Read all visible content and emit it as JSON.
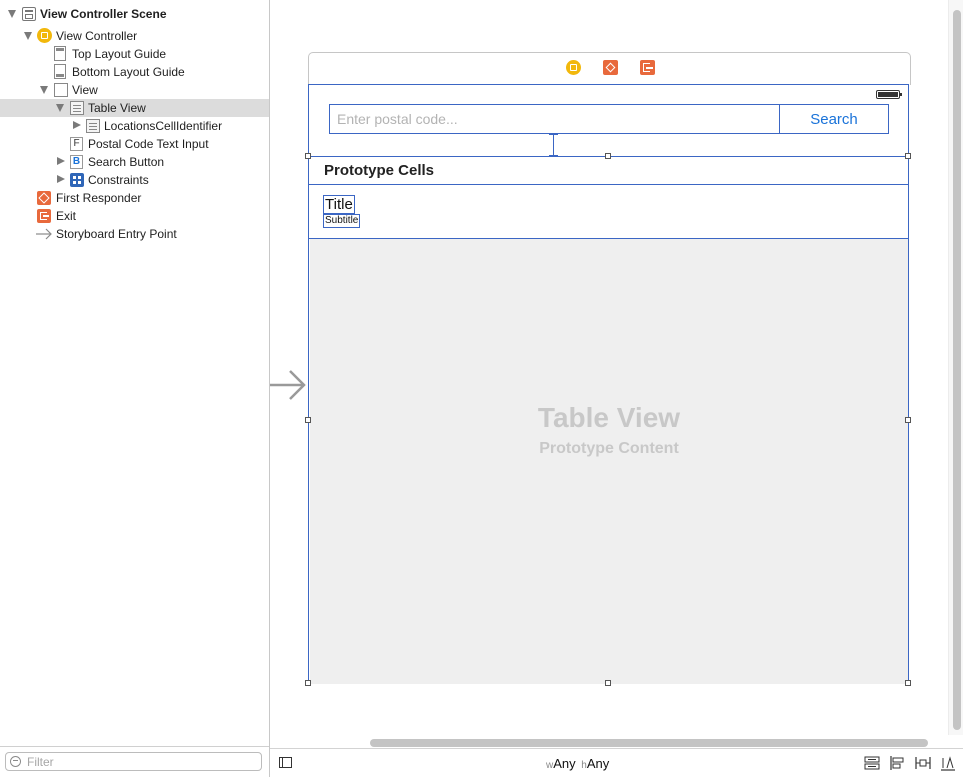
{
  "outline": {
    "items": [
      {
        "label": "View Controller Scene",
        "icon": "scene-icon"
      },
      {
        "label": "View Controller",
        "icon": "view-controller-icon"
      },
      {
        "label": "Top Layout Guide",
        "icon": "layout-guide-icon"
      },
      {
        "label": "Bottom Layout Guide",
        "icon": "layout-guide-icon"
      },
      {
        "label": "View",
        "icon": "view-icon"
      },
      {
        "label": "Table View",
        "icon": "table-view-icon"
      },
      {
        "label": "LocationsCellIdentifier",
        "icon": "table-cell-icon"
      },
      {
        "label": "Postal Code Text Input",
        "icon": "text-field-icon",
        "badge": "F"
      },
      {
        "label": "Search Button",
        "icon": "button-icon",
        "badge": "B"
      },
      {
        "label": "Constraints",
        "icon": "constraints-icon"
      },
      {
        "label": "First Responder",
        "icon": "first-responder-icon"
      },
      {
        "label": "Exit",
        "icon": "exit-icon"
      },
      {
        "label": "Storyboard Entry Point",
        "icon": "entry-arrow-icon"
      }
    ],
    "filter_placeholder": "Filter"
  },
  "scene": {
    "search_placeholder": "Enter postal code...",
    "search_button": "Search",
    "section_header": "Prototype Cells",
    "cell_title": "Title",
    "cell_subtitle": "Subtitle",
    "table_watermark_title": "Table View",
    "table_watermark_subtitle": "Prototype Content"
  },
  "bottom_bar": {
    "w_prefix": "w",
    "w_value": "Any",
    "h_prefix": "h",
    "h_value": "Any"
  },
  "colors": {
    "accent_blue": "#3b66c4",
    "button_text": "#1a73d9",
    "orange": "#e8693c",
    "yellow": "#f2b80c",
    "selection": "#dcdcdc"
  }
}
